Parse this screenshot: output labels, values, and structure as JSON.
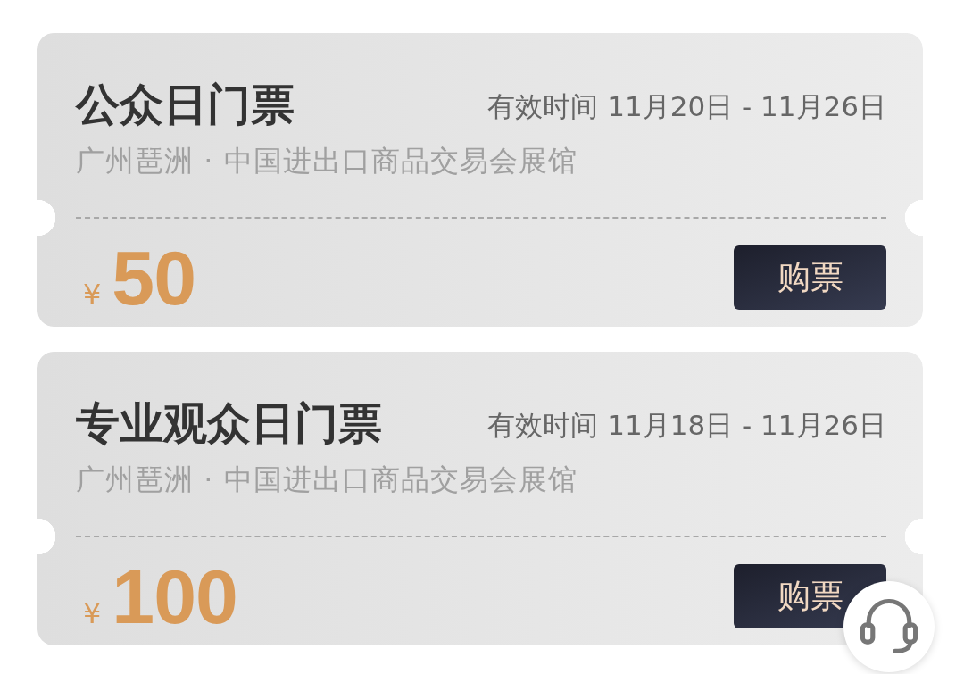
{
  "tickets": [
    {
      "title": "公众日门票",
      "validity": "有效时间 11月20日 - 11月26日",
      "venue": "广州琶洲 · 中国进出口商品交易会展馆",
      "currency": "¥",
      "price": "50",
      "button": "购票"
    },
    {
      "title": "专业观众日门票",
      "validity": "有效时间 11月18日 - 11月26日",
      "venue": "广州琶洲 · 中国进出口商品交易会展馆",
      "currency": "¥",
      "price": "100",
      "button": "购票"
    }
  ]
}
